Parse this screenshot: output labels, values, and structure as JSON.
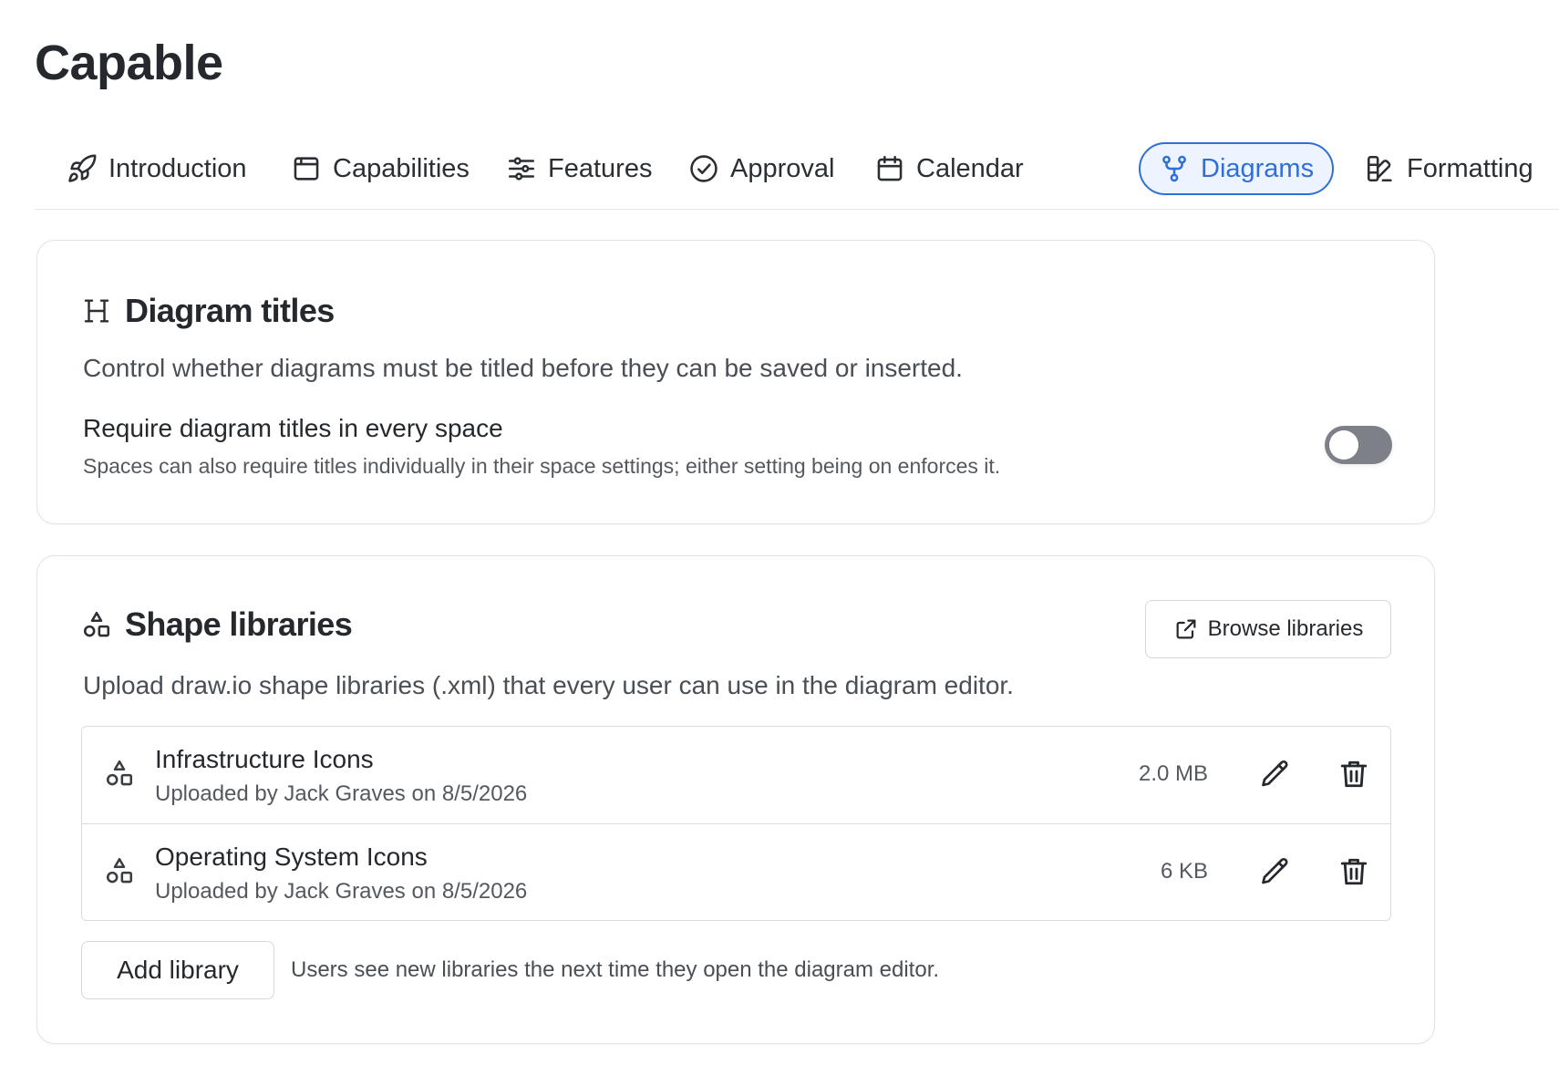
{
  "page": {
    "title": "Capable"
  },
  "tabs": [
    {
      "label": "Introduction",
      "icon": "rocket-icon",
      "active": false
    },
    {
      "label": "Capabilities",
      "icon": "box-icon",
      "active": false
    },
    {
      "label": "Features",
      "icon": "sliders-icon",
      "active": false
    },
    {
      "label": "Approval",
      "icon": "check-circle-icon",
      "active": false
    },
    {
      "label": "Calendar",
      "icon": "calendar-icon",
      "active": false
    },
    {
      "label": "Diagrams",
      "icon": "git-fork-icon",
      "active": true
    },
    {
      "label": "Formatting",
      "icon": "palette-icon",
      "active": false
    }
  ],
  "diagram_titles": {
    "heading": "Diagram titles",
    "icon": "heading-icon",
    "description": "Control whether diagrams must be titled before they can be saved or inserted.",
    "setting_label": "Require diagram titles in every space",
    "setting_help": "Spaces can also require titles individually in their space settings; either setting being on enforces it.",
    "toggle_on": false
  },
  "shape_libraries": {
    "heading": "Shape libraries",
    "icon": "shapes-icon",
    "browse_label": "Browse libraries",
    "description": "Upload draw.io shape libraries (.xml) that every user can use in the diagram editor.",
    "items": [
      {
        "name": "Infrastructure Icons",
        "meta": "Uploaded by Jack Graves on 8/5/2026",
        "size": "2.0 MB"
      },
      {
        "name": "Operating System Icons",
        "meta": "Uploaded by Jack Graves on 8/5/2026",
        "size": "6 KB"
      }
    ],
    "add_label": "Add library",
    "add_note": "Users see new libraries the next time they open the diagram editor."
  },
  "colors": {
    "accent": "#2f6fd8",
    "accent_bg": "#eef4ff",
    "toggle_off": "#7d8187",
    "border": "#e1e3e6"
  }
}
